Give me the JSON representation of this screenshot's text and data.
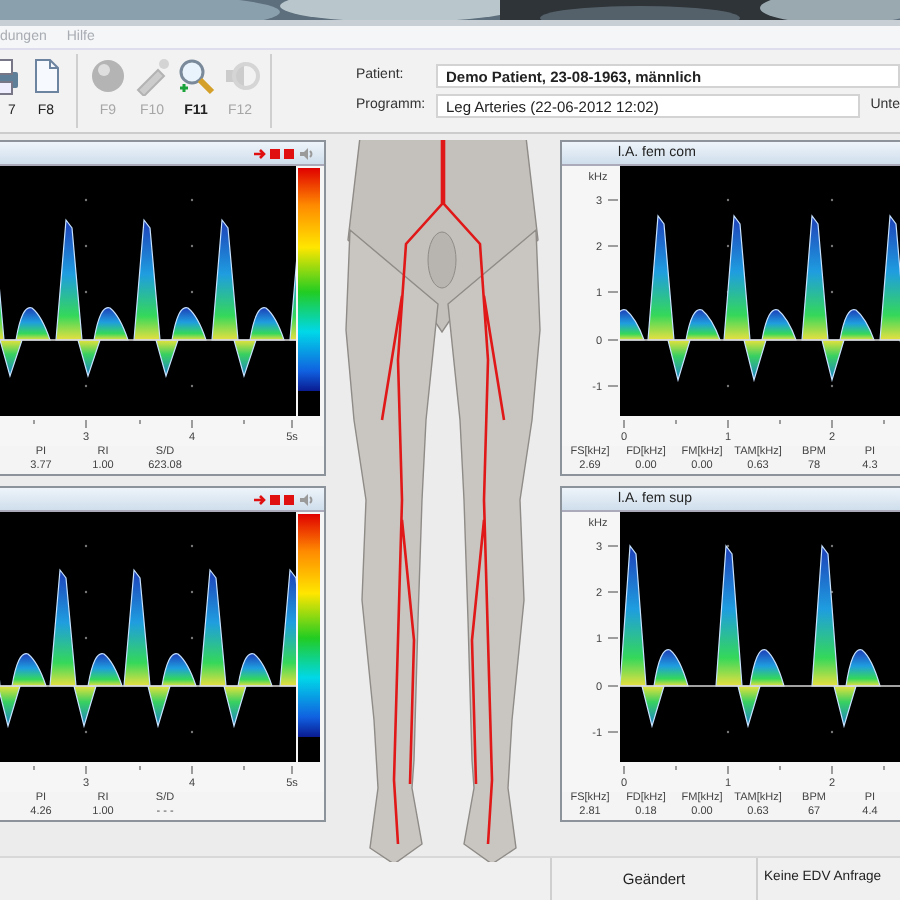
{
  "desktop": {
    "kind": "picture"
  },
  "menu": [
    {
      "label": "dungen"
    },
    {
      "label": "Hilfe"
    }
  ],
  "toolbar": [
    {
      "key": "7",
      "kind": "printer",
      "disabled": false
    },
    {
      "key": "F8",
      "kind": "document",
      "disabled": false
    },
    {
      "key": "F9",
      "kind": "sphere",
      "disabled": true
    },
    {
      "key": "F10",
      "kind": "probe",
      "disabled": true
    },
    {
      "key": "F11",
      "kind": "magnifier",
      "disabled": false
    },
    {
      "key": "F12",
      "kind": "speaker",
      "disabled": true
    }
  ],
  "patient": {
    "label": "Patient:",
    "value": "Demo Patient, 23-08-1963, männlich"
  },
  "program": {
    "label": "Programm:",
    "value": "Leg Arteries (22-06-2012 12:02)",
    "cut_label": "Unte"
  },
  "left_panels": [
    {
      "x_ticks": [
        "3",
        "4",
        "5s"
      ],
      "metrics": [
        {
          "label": "PI",
          "value": "3.77"
        },
        {
          "label": "RI",
          "value": "1.00"
        },
        {
          "label": "S/D",
          "value": "623.08"
        }
      ]
    },
    {
      "x_ticks": [
        "3",
        "4",
        "5s"
      ],
      "metrics": [
        {
          "label": "PI",
          "value": "4.26"
        },
        {
          "label": "RI",
          "value": "1.00"
        },
        {
          "label": "S/D",
          "value": "- - -"
        }
      ]
    }
  ],
  "right_panels": [
    {
      "title": "l.A. fem com",
      "y_unit": "kHz",
      "y_ticks": [
        "3",
        "2",
        "1",
        "0",
        "-1"
      ],
      "x_ticks": [
        "0",
        "1",
        "2"
      ],
      "metrics": [
        {
          "label": "FS[kHz]",
          "value": "2.69"
        },
        {
          "label": "FD[kHz]",
          "value": "0.00"
        },
        {
          "label": "FM[kHz]",
          "value": "0.00"
        },
        {
          "label": "TAM[kHz]",
          "value": "0.63"
        },
        {
          "label": "BPM",
          "value": "78"
        },
        {
          "label": "PI",
          "value": "4.3"
        }
      ]
    },
    {
      "title": "l.A. fem sup",
      "y_unit": "kHz",
      "y_ticks": [
        "3",
        "2",
        "1",
        "0",
        "-1"
      ],
      "x_ticks": [
        "0",
        "1",
        "2"
      ],
      "metrics": [
        {
          "label": "FS[kHz]",
          "value": "2.81"
        },
        {
          "label": "FD[kHz]",
          "value": "0.18"
        },
        {
          "label": "FM[kHz]",
          "value": "0.00"
        },
        {
          "label": "TAM[kHz]",
          "value": "0.63"
        },
        {
          "label": "BPM",
          "value": "67"
        },
        {
          "label": "PI",
          "value": "4.4"
        }
      ]
    }
  ],
  "status_bar": [
    "Geändert",
    "Keine EDV Anfrage"
  ]
}
